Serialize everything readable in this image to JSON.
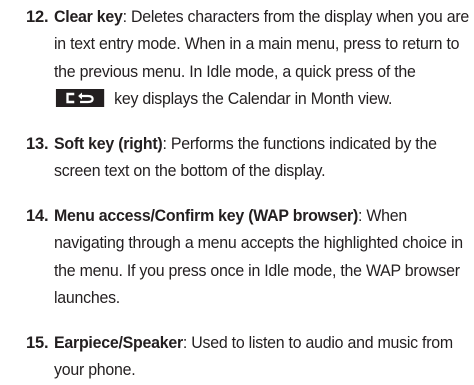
{
  "items": [
    {
      "number": "12.",
      "term": "Clear key",
      "text_before_icon": ": Deletes characters from the display when you are in text entry mode. When in a main menu, press to return to the previous menu. In Idle mode, a quick press of the ",
      "icon": "clear-back-key-icon",
      "text_after_icon": " key displays the Calendar in Month view."
    },
    {
      "number": "13.",
      "term": "Soft key (right)",
      "text": ": Performs the functions indicated by the screen text on the bottom of the display."
    },
    {
      "number": "14.",
      "term": "Menu access/Confirm key (WAP browser)",
      "text": ": When navigating through a menu accepts the highlighted choice in the menu. If you press once in Idle mode, the WAP browser launches."
    },
    {
      "number": "15.",
      "term": "Earpiece/Speaker",
      "text": ": Used to listen to audio and music from your phone."
    }
  ]
}
